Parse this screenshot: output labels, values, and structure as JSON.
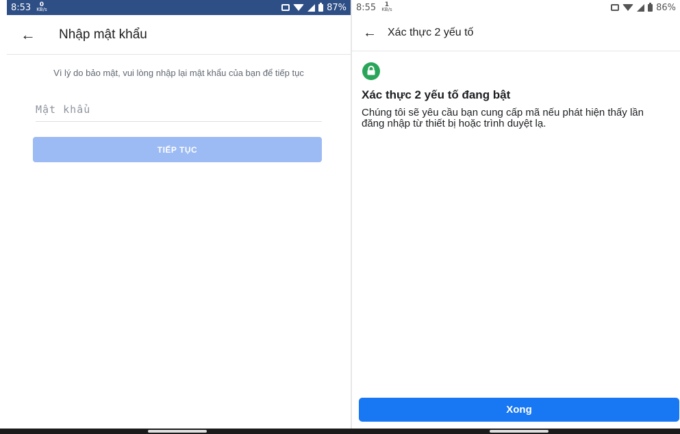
{
  "left": {
    "status": {
      "time": "8:53",
      "speed_value": "0",
      "speed_unit": "KB/s",
      "battery": "87%"
    },
    "header": {
      "title": "Nhập mật khẩu"
    },
    "notice": "Vì lý do bảo mật, vui lòng nhập lại mật khẩu của bạn để tiếp tục",
    "password": {
      "placeholder": "Mật khẩu",
      "value": ""
    },
    "continue_label": "TIẾP TỤC",
    "colors": {
      "statusbar": "#2e4e86",
      "button_disabled": "#9cbaf3"
    }
  },
  "right": {
    "status": {
      "time": "8:55",
      "speed_value": "1",
      "speed_unit": "KB/s",
      "battery": "86%"
    },
    "header": {
      "title": "Xác thực 2 yếu tố"
    },
    "headline": "Xác thực 2 yếu tố đang bật",
    "description": "Chúng tôi sẽ yêu cầu bạn cung cấp mã nếu phát hiện thấy lần đăng nhập từ thiết bị hoặc trình duyệt lạ.",
    "done_label": "Xong",
    "icons": {
      "badge": "lock-icon",
      "back": "arrow-left-icon"
    },
    "colors": {
      "badge": "#29a55a",
      "primary": "#1877f2"
    }
  }
}
